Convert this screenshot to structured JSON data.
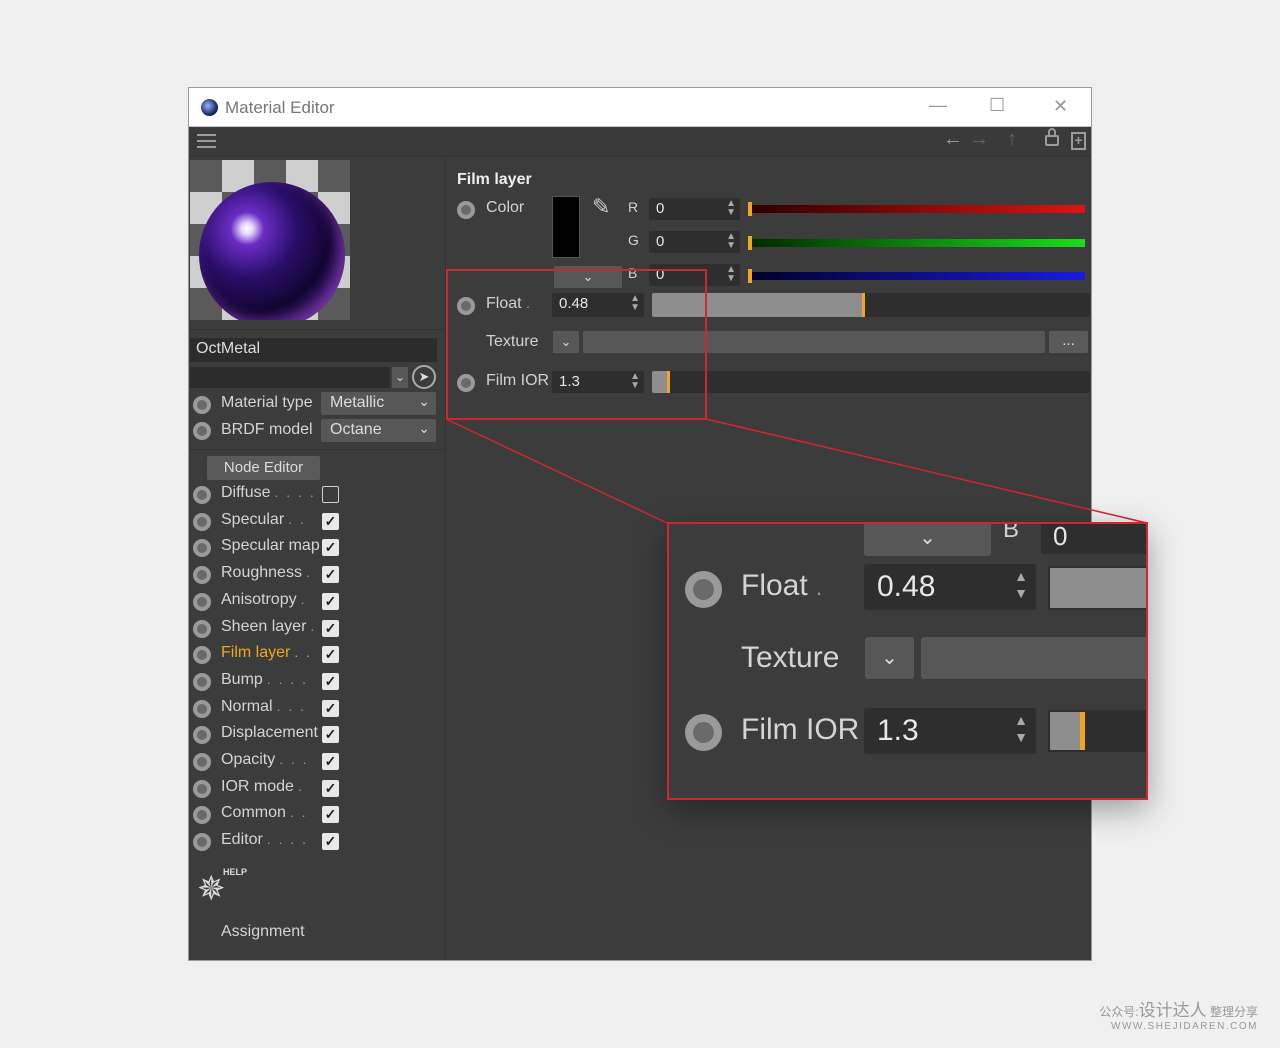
{
  "window": {
    "title": "Material Editor",
    "controls": {
      "minimize": "—",
      "maximize": "☐",
      "close": "✕"
    }
  },
  "toolbar": {
    "menu_icon": "hamburger-icon"
  },
  "material": {
    "name": "OctMetal",
    "type_label": "Material type",
    "type_value": "Metallic",
    "brdf_label": "BRDF model",
    "brdf_value": "Octane",
    "node_editor_label": "Node Editor"
  },
  "channels": [
    {
      "label": "Diffuse",
      "dots": ". . . .",
      "checked": false,
      "active": false
    },
    {
      "label": "Specular",
      "dots": ". .",
      "checked": true,
      "active": false
    },
    {
      "label": "Specular map",
      "dots": "",
      "checked": true,
      "active": false
    },
    {
      "label": "Roughness",
      "dots": ".",
      "checked": true,
      "active": false
    },
    {
      "label": "Anisotropy",
      "dots": ".",
      "checked": true,
      "active": false
    },
    {
      "label": "Sheen layer",
      "dots": ".",
      "checked": true,
      "active": false
    },
    {
      "label": "Film layer",
      "dots": ". .",
      "checked": true,
      "active": true
    },
    {
      "label": "Bump",
      "dots": ". . . .",
      "checked": true,
      "active": false
    },
    {
      "label": "Normal",
      "dots": ". . .",
      "checked": true,
      "active": false
    },
    {
      "label": "Displacement",
      "dots": "",
      "checked": true,
      "active": false
    },
    {
      "label": "Opacity",
      "dots": ". . .",
      "checked": true,
      "active": false
    },
    {
      "label": "IOR mode",
      "dots": ".",
      "checked": true,
      "active": false
    },
    {
      "label": "Common",
      "dots": ". .",
      "checked": true,
      "active": false
    },
    {
      "label": "Editor",
      "dots": ". . . .",
      "checked": true,
      "active": false
    }
  ],
  "help": {
    "badge": "HELP",
    "assignment_label": "Assignment"
  },
  "film_layer": {
    "heading": "Film layer",
    "color_label": "Color",
    "swatch_color": "#000000",
    "r_label": "R",
    "r_value": "0",
    "g_label": "G",
    "g_value": "0",
    "b_label": "B",
    "b_value": "0",
    "float_label": "Float",
    "float_value": "0.48",
    "float_fraction": 0.48,
    "texture_label": "Texture",
    "texture_more": "...",
    "film_ior_label": "Film IOR",
    "film_ior_value": "1.3",
    "accent_color": "#f0a623",
    "highlight_color": "#d0262f"
  },
  "watermark": {
    "line1_prefix": "公众号:",
    "line1_brand": "设计达人",
    "line1_suffix": "整理分享",
    "line2": "WWW.SHEJIDAREN.COM"
  }
}
